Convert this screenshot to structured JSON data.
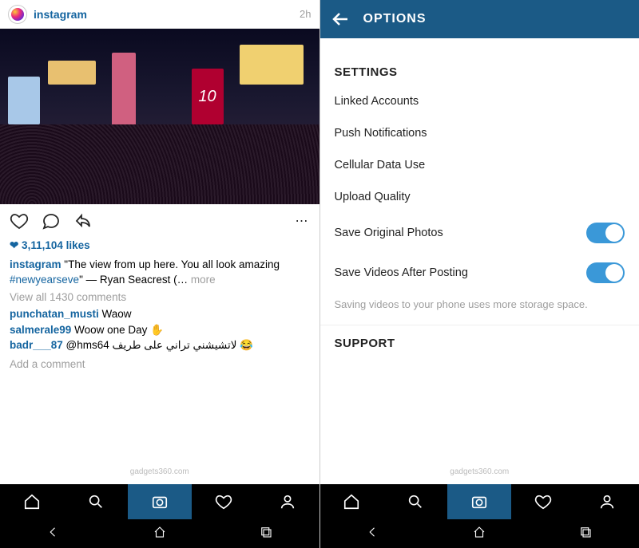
{
  "left": {
    "header": {
      "username": "instagram",
      "time": "2h"
    },
    "billboard_number": "10",
    "likes_text": "3,11,104 likes",
    "caption": {
      "user": "instagram",
      "text_before": "\"The view from up here. You all look amazing ",
      "hashtag": "#newyearseve",
      "text_after": "\" — Ryan Seacrest (…",
      "more": " more"
    },
    "view_all": "View all 1430 comments",
    "comments": [
      {
        "user": "punchatan_musti",
        "text": " Waow"
      },
      {
        "user": "salmerale99",
        "text": " Woow one Day ✋"
      },
      {
        "user": "badr___87",
        "text": " @hms64 لاتشيشني تراني على طريف 😂"
      }
    ],
    "add_comment": "Add a comment"
  },
  "right": {
    "title": "OPTIONS",
    "sections": {
      "settings": {
        "header": "SETTINGS",
        "items": {
          "linked": "Linked Accounts",
          "push": "Push Notifications",
          "cellular": "Cellular Data Use",
          "upload": "Upload Quality",
          "save_photos": "Save Original Photos",
          "save_videos": "Save Videos After Posting"
        },
        "helper": "Saving videos to your phone uses more storage space."
      },
      "support": {
        "header": "SUPPORT"
      }
    }
  },
  "watermark": "gadgets360.com"
}
